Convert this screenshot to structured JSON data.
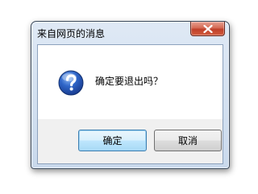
{
  "dialog": {
    "title": "来自网页的消息",
    "message": "确定要退出吗？",
    "icon": "question-icon",
    "ok_label": "确定",
    "cancel_label": "取消",
    "close_icon": "close-icon"
  }
}
